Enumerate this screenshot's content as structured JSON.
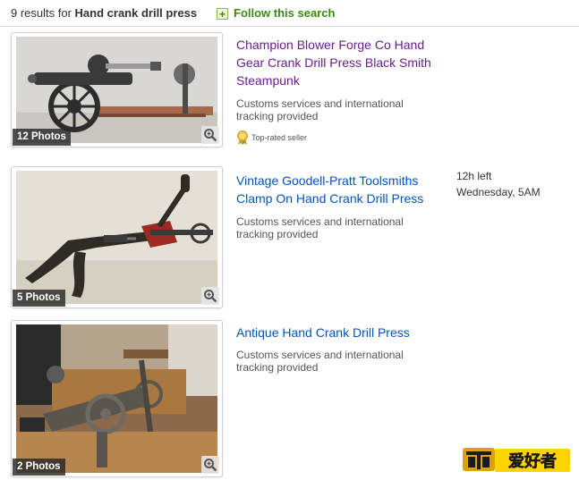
{
  "results_header": {
    "count_text": "9 results for",
    "query": "Hand crank drill press",
    "follow_label": "Follow this search",
    "follow_icon": "plus-icon"
  },
  "listings": [
    {
      "title": "Champion Blower Forge Co Hand Gear Crank Drill Press Black Smith Steampunk",
      "photos": "12 Photos",
      "customs": "Customs services and international tracking provided",
      "badge": "Top-rated seller",
      "visited": true
    },
    {
      "title": "Vintage Goodell-Pratt Toolsmiths Clamp On Hand Crank Drill Press",
      "photos": "5 Photos",
      "customs": "Customs services and international tracking provided",
      "time_left": "12h left",
      "end_time": "Wednesday, 5AM"
    },
    {
      "title": "Antique Hand Crank Drill Press",
      "photos": "2 Photos",
      "customs": "Customs services and international tracking provided"
    }
  ],
  "watermark": {
    "logo_text": "爱好者"
  },
  "colors": {
    "link": "#0654ba",
    "visited_link": "#6a1e8c",
    "follow_green": "#3a8a10"
  }
}
